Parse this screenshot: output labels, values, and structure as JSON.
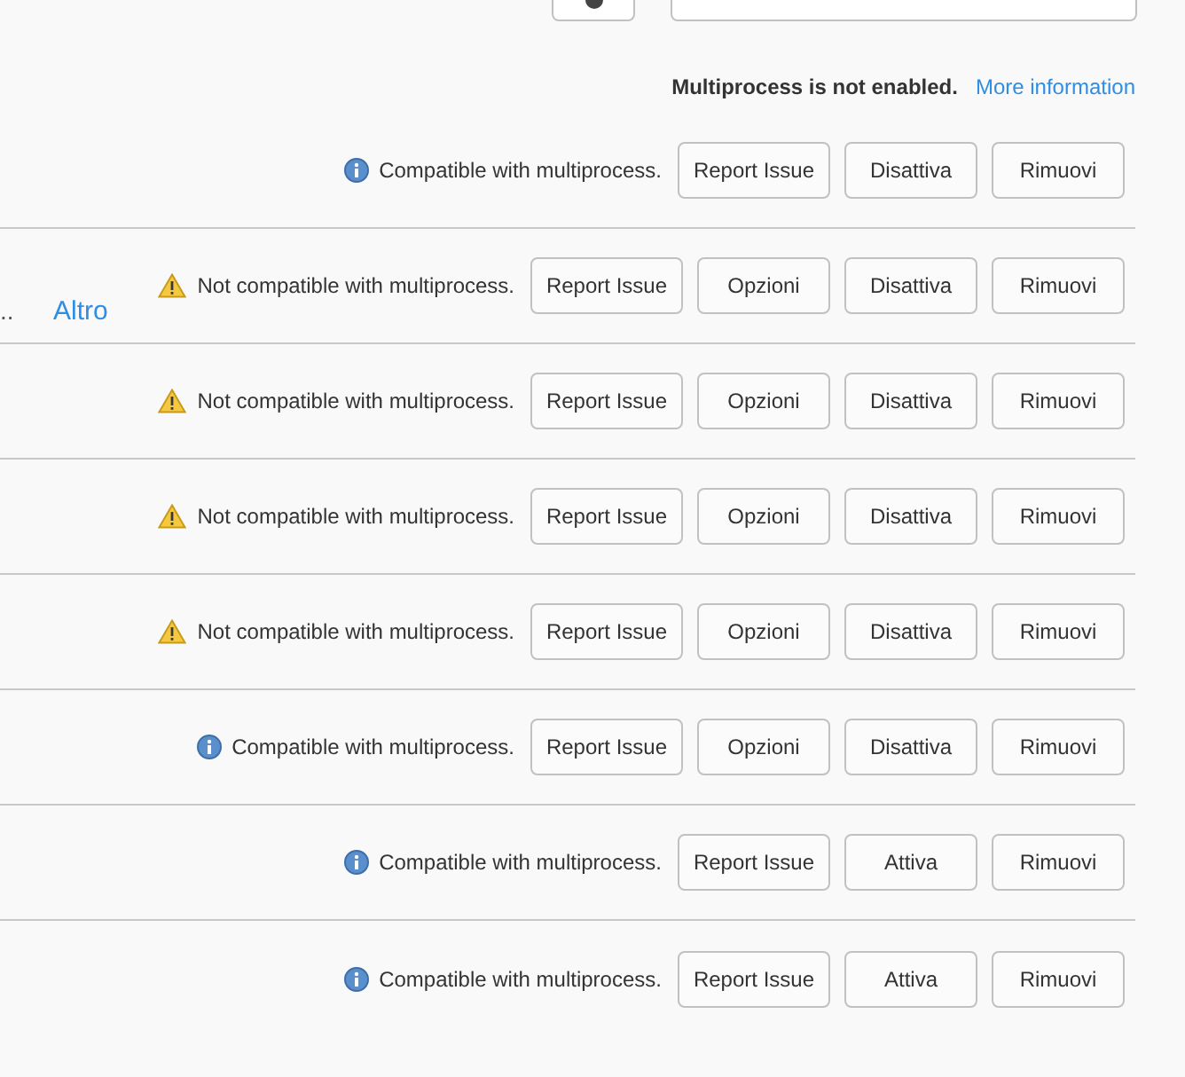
{
  "notice": {
    "message": "Multiprocess is not enabled.",
    "link": "More information"
  },
  "addons": [
    {
      "kind": "compatible",
      "message": "Compatible with multiprocess.",
      "buttons": [
        "Report Issue",
        "Disattiva",
        "Rimuovi"
      ]
    },
    {
      "kind": "incompatible",
      "message": "Not compatible with multiprocess.",
      "buttons": [
        "Report Issue",
        "Opzioni",
        "Disattiva",
        "Rimuovi"
      ],
      "truncated_text": "..",
      "more_link": "Altro"
    },
    {
      "kind": "incompatible",
      "message": "Not compatible with multiprocess.",
      "buttons": [
        "Report Issue",
        "Opzioni",
        "Disattiva",
        "Rimuovi"
      ]
    },
    {
      "kind": "incompatible",
      "message": "Not compatible with multiprocess.",
      "buttons": [
        "Report Issue",
        "Opzioni",
        "Disattiva",
        "Rimuovi"
      ]
    },
    {
      "kind": "incompatible",
      "message": "Not compatible with multiprocess.",
      "buttons": [
        "Report Issue",
        "Opzioni",
        "Disattiva",
        "Rimuovi"
      ]
    },
    {
      "kind": "compatible",
      "message": "Compatible with multiprocess.",
      "buttons": [
        "Report Issue",
        "Opzioni",
        "Disattiva",
        "Rimuovi"
      ]
    },
    {
      "kind": "compatible",
      "message": "Compatible with multiprocess.",
      "buttons": [
        "Report Issue",
        "Attiva",
        "Rimuovi"
      ]
    },
    {
      "kind": "compatible",
      "message": "Compatible with multiprocess.",
      "buttons": [
        "Report Issue",
        "Attiva",
        "Rimuovi"
      ]
    }
  ]
}
